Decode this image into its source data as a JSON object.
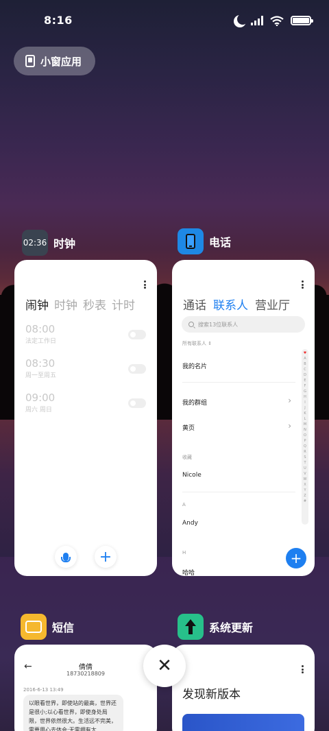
{
  "status_bar": {
    "time": "8:16",
    "battery_level": 1.0
  },
  "mini_window": {
    "label": "小窗应用"
  },
  "apps": {
    "clock": {
      "name": "时钟",
      "icon_text": "02:36",
      "tabs": [
        "闹钟",
        "时钟",
        "秒表",
        "计时"
      ],
      "alarms": [
        {
          "time": "08:00",
          "desc": "法定工作日"
        },
        {
          "time": "08:30",
          "desc": "周一至周五"
        },
        {
          "time": "09:00",
          "desc": "周六 周日"
        }
      ]
    },
    "phone": {
      "name": "电话",
      "tabs": [
        "通话",
        "联系人",
        "营业厅"
      ],
      "search_placeholder": "搜索13位联系人",
      "all_contacts": "所有联系人",
      "my_card": "我的名片",
      "my_groups": "我的群组",
      "yellow_pages": "黄页",
      "favorites_header": "收藏",
      "fav_contact": "Nicole",
      "section_a": "A",
      "contact_a": "Andy",
      "section_h": "H",
      "contact_h": "哈哈",
      "alphabet": [
        "♥",
        "A",
        "B",
        "C",
        "D",
        "E",
        "F",
        "G",
        "H",
        "I",
        "J",
        "K",
        "L",
        "M",
        "N",
        "O",
        "P",
        "Q",
        "R",
        "S",
        "T",
        "U",
        "V",
        "W",
        "X",
        "Y",
        "Z",
        "#"
      ]
    },
    "sms": {
      "name": "短信",
      "contact_name": "倩倩",
      "contact_number": "18730218809",
      "date": "2016-6-13 13:49",
      "message": "以眼看世界，即使站的最高，世界还是很小;以心看世界，即使身处局限，世界依然很大。生活远不完美，需要用心去体会;无需拥有太"
    },
    "update": {
      "name": "系统更新",
      "headline": "发现新版本"
    }
  },
  "colors": {
    "accent": "#1e7ff0",
    "update_green": "#27c08a",
    "sms_yellow": "#f5b82e"
  }
}
